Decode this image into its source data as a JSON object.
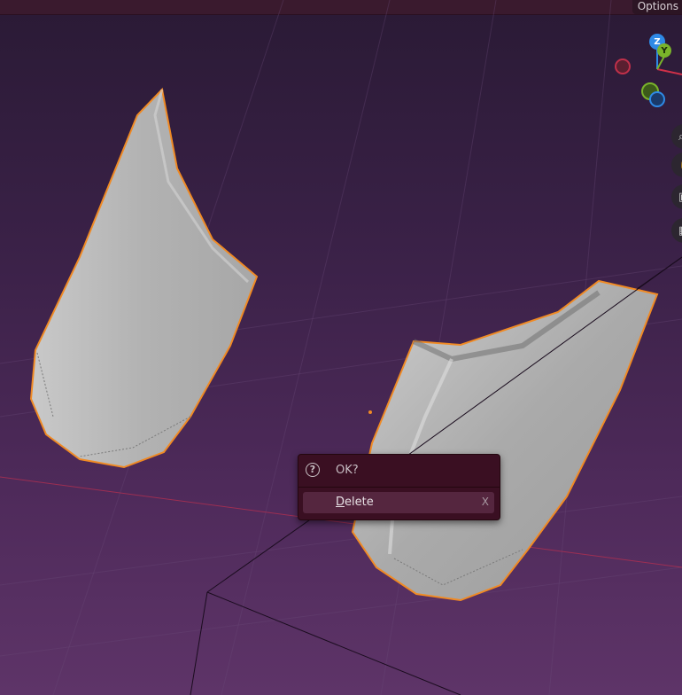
{
  "header": {
    "options_label": "Options"
  },
  "gizmo": {
    "z_label": "Z",
    "y_label": "Y"
  },
  "dialog": {
    "title": "OK?",
    "delete_first_letter": "D",
    "delete_rest": "elete",
    "delete_shortcut": "X"
  },
  "colors": {
    "accent_selection": "#f08a24",
    "dialog_bg": "#3a0f22",
    "dialog_row": "#55263f",
    "axis_x": "#d03048",
    "axis_y": "#7ab32a",
    "axis_z": "#2e8ae6"
  }
}
